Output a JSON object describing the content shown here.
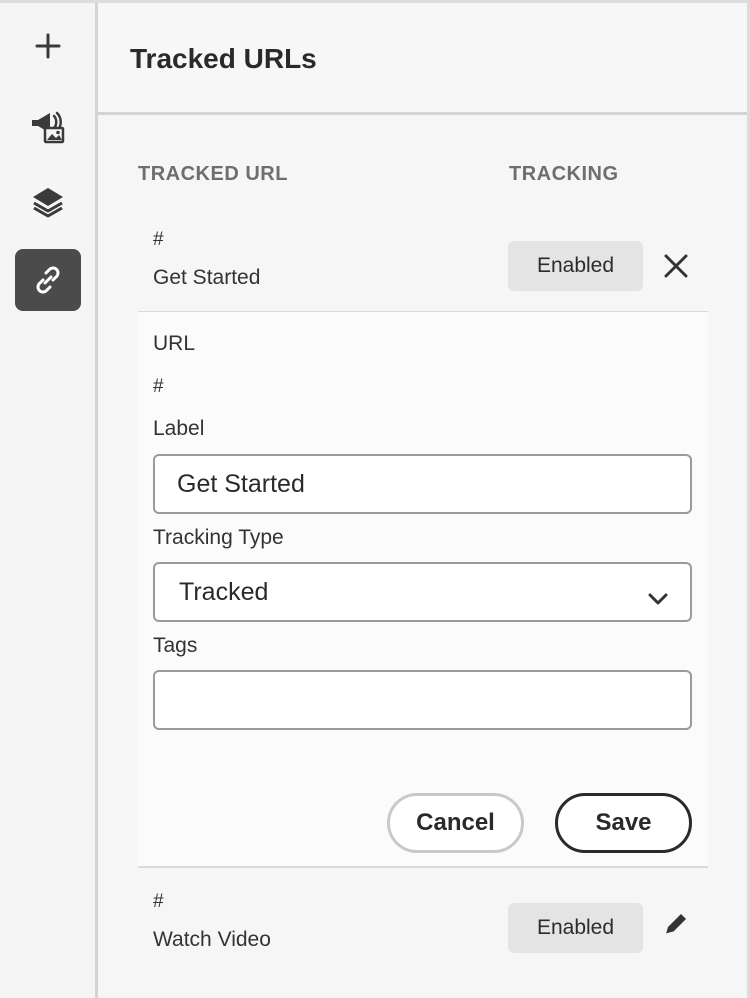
{
  "rail": {
    "items": [
      {
        "name": "add-icon"
      },
      {
        "name": "campaign-icon"
      },
      {
        "name": "layers-icon"
      },
      {
        "name": "link-icon",
        "active": true
      }
    ]
  },
  "header": {
    "title": "Tracked URLs"
  },
  "table": {
    "columns": [
      "TRACKED URL",
      "TRACKING"
    ],
    "rows": [
      {
        "url": "#",
        "label": "Get Started",
        "tracking": "Enabled",
        "action": "close-icon",
        "expanded": true
      },
      {
        "url": "#",
        "label": "Watch Video",
        "tracking": "Enabled",
        "action": "pencil-icon",
        "expanded": false
      }
    ]
  },
  "editor": {
    "url_label": "URL",
    "url_value": "#",
    "label_label": "Label",
    "label_value": "Get Started",
    "tracking_type_label": "Tracking Type",
    "tracking_type_value": "Tracked",
    "tags_label": "Tags",
    "tags_value": "",
    "cancel_label": "Cancel",
    "save_label": "Save"
  },
  "colors": {
    "active_rail": "#4b4b4b",
    "badge_bg": "#e4e4e4",
    "panel_bg": "#fbfbfb"
  }
}
